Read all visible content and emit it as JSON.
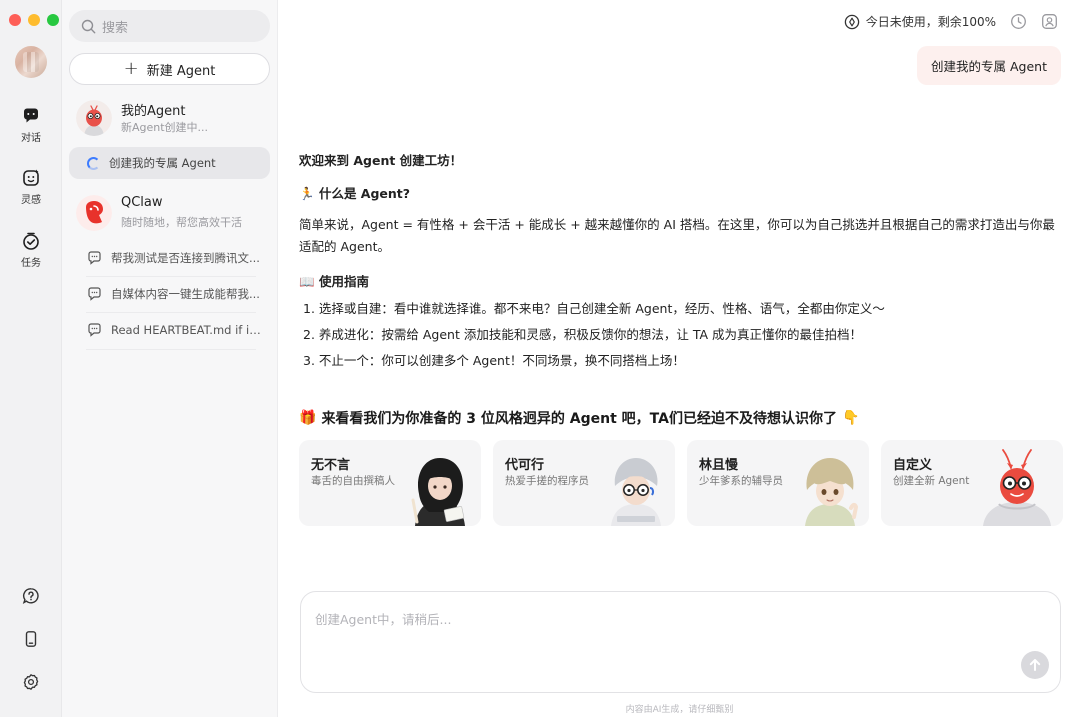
{
  "sidebar": {
    "rail": [
      {
        "label": "对话",
        "icon": "chat-icon"
      },
      {
        "label": "灵感",
        "icon": "inspiration-icon"
      },
      {
        "label": "任务",
        "icon": "task-icon"
      }
    ],
    "search_placeholder": "搜索",
    "new_agent_label": "新建 Agent",
    "agents": [
      {
        "name": "我的Agent",
        "subtitle": "新Agent创建中..."
      },
      {
        "name": "QClaw",
        "subtitle": "随时随地，帮您高效干活"
      }
    ],
    "active_session": "创建我的专属 Agent",
    "sessions": [
      "帮我测试是否连接到腾讯文...",
      "自媒体内容一键生成能帮我...",
      "Read HEARTBEAT.md if it..."
    ]
  },
  "header": {
    "usage_text": "今日未使用，剩余100%"
  },
  "conversation": {
    "user_message": "创建我的专属 Agent",
    "welcome": "欢迎来到 Agent 创建工坊！",
    "what_is_heading": "什么是 Agent?",
    "what_is_emoji": "🏃",
    "what_is_body": "简单来说，Agent = 有性格 + 会干活 + 能成长 + 越来越懂你的 AI 搭档。在这里，你可以为自己挑选并且根据自己的需求打造出与你最适配的 Agent。",
    "guide_heading": "使用指南",
    "guide_emoji": "📖",
    "guide_items": [
      "1. 选择或自建：看中谁就选择谁。都不来电？自己创建全新 Agent，经历、性格、语气，全都由你定义～",
      "2. 养成进化：按需给 Agent 添加技能和灵感，积极反馈你的想法，让 TA 成为真正懂你的最佳拍档！",
      "3. 不止一个：你可以创建多个 Agent！不同场景，换不同搭档上场！"
    ],
    "gallery_title": "来看看我们为你准备的 3 位风格迥异的 Agent 吧，TA们已经迫不及待想认识你了",
    "gallery_emoji_start": "🎁",
    "gallery_emoji_end": "👇",
    "agent_cards": [
      {
        "name": "无不言",
        "desc": "毒舌的自由撰稿人"
      },
      {
        "name": "代可行",
        "desc": "热爱手搓的程序员"
      },
      {
        "name": "林且慢",
        "desc": "少年爹系的辅导员"
      },
      {
        "name": "自定义",
        "desc": "创建全新 Agent"
      }
    ]
  },
  "composer": {
    "placeholder": "创建Agent中，请稍后...",
    "footnote": "内容由AI生成，请仔细甄别"
  },
  "colors": {
    "accent_blue": "#3d7cff",
    "user_bubble": "#fdf0ee",
    "qclaw_red": "#e8322b"
  }
}
